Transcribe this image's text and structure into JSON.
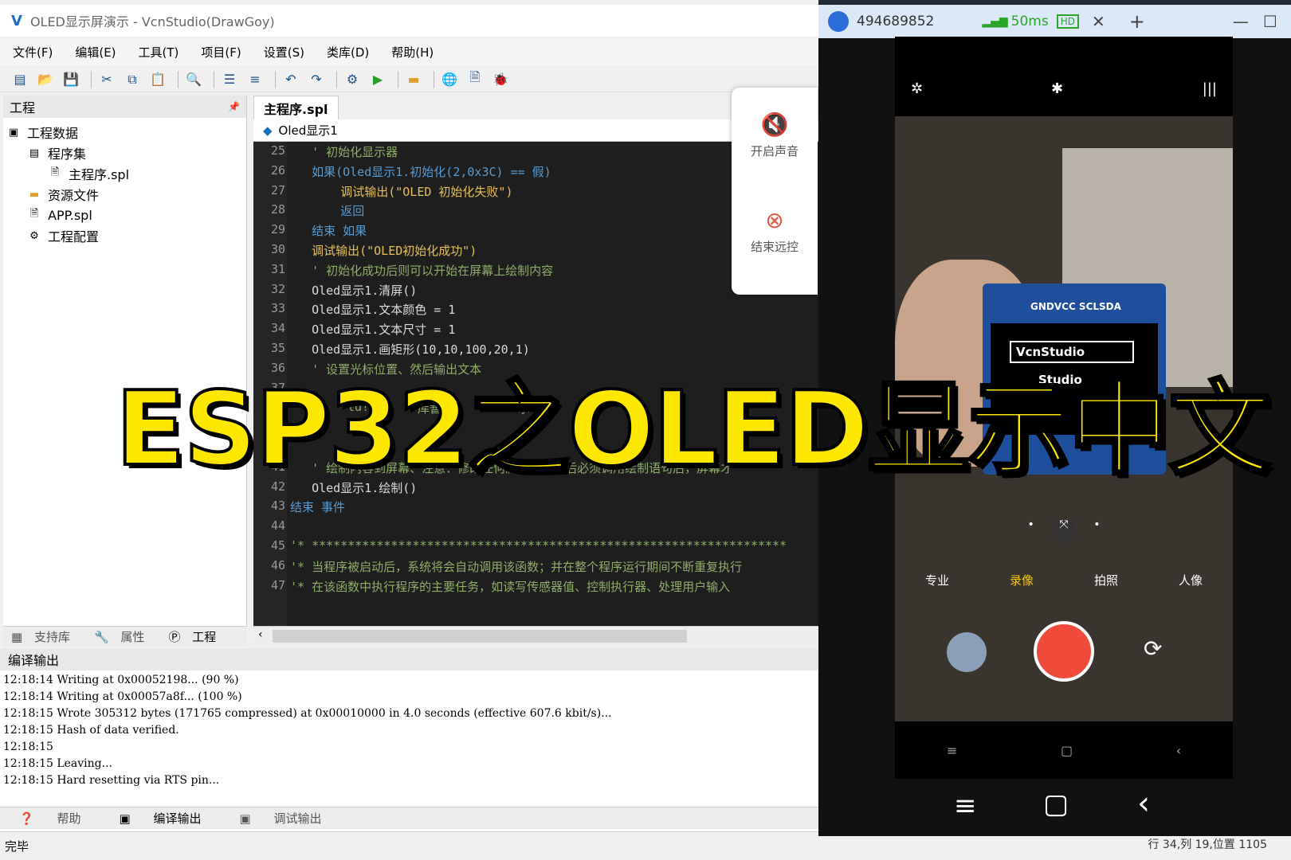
{
  "window": {
    "title": "OLED显示屏演示 - VcnStudio(DrawGoy)",
    "logo": "V"
  },
  "menu": [
    "文件(F)",
    "编辑(E)",
    "工具(T)",
    "项目(F)",
    "设置(S)",
    "类库(D)",
    "帮助(H)"
  ],
  "project_panel": {
    "title": "工程",
    "pin": "📌",
    "items": [
      "工程数据",
      "程序集",
      "主程序.spl",
      "资源文件",
      "APP.spl",
      "工程配置"
    ],
    "tabs": [
      "支持库",
      "属性",
      "工程"
    ]
  },
  "editor": {
    "tab": "主程序.spl",
    "object_combo": "Oled显示1",
    "lines": [
      {
        "n": "25",
        "text": "   ' 初始化显示器"
      },
      {
        "n": "26",
        "text": "   如果(Oled显示1.初始化(2,0x3C) == 假)"
      },
      {
        "n": "27",
        "text": "       调试输出(\"OLED 初始化失败\")"
      },
      {
        "n": "28",
        "text": "       返回"
      },
      {
        "n": "29",
        "text": "   结束 如果"
      },
      {
        "n": "30",
        "text": "   调试输出(\"OLED初始化成功\")"
      },
      {
        "n": "31",
        "text": "   ' 初始化成功后则可以开始在屏幕上绘制内容"
      },
      {
        "n": "32",
        "text": "   Oled显示1.清屏()"
      },
      {
        "n": "33",
        "text": "   Oled显示1.文本颜色 = 1"
      },
      {
        "n": "34",
        "text": "   Oled显示1.文本尺寸 = 1"
      },
      {
        "n": "35",
        "text": "   Oled显示1.画矩形(10,10,100,20,1)"
      },
      {
        "n": "36",
        "text": "   ' 设置光标位置、然后输出文本"
      },
      {
        "n": "37",
        "text": ""
      },
      {
        "n": "38",
        "text": ""
      },
      {
        "n": "39",
        "text": ""
      },
      {
        "n": "40",
        "text": ""
      },
      {
        "n": "41",
        "text": "   ' 绘制内容到屏幕、注意：修改任何属性或内容后必须调用绘制语句后，屏幕才"
      },
      {
        "n": "42",
        "text": "   Oled显示1.绘制()"
      },
      {
        "n": "43",
        "text": "结束 事件"
      },
      {
        "n": "44",
        "text": ""
      },
      {
        "n": "45",
        "text": "'* ******************************************************************"
      },
      {
        "n": "46",
        "text": "'* 当程序被启动后，系统将会自动调用该函数；并在整个程序运行期间不断重复执行"
      },
      {
        "n": "47",
        "text": "'* 在该函数中执行程序的主要任务，如读写传感器值、控制执行器、处理用户输入"
      }
    ],
    "hidden_fragments": [
      "ld!",
      "库暂不",
      "示"
    ]
  },
  "side_popup": {
    "sound_label": "开启声音",
    "stop_label": "结束远控"
  },
  "output": {
    "title": "编译输出",
    "lines": [
      "12:18:14 Writing at 0x00052198... (90 %)",
      "12:18:14 Writing at 0x00057a8f... (100 %)",
      "12:18:15 Wrote 305312 bytes (171765 compressed) at 0x00010000 in 4.0 seconds (effective 607.6 kbit/s)...",
      "12:18:15 Hash of data verified.",
      "12:18:15",
      "12:18:15 Leaving...",
      "12:18:15 Hard resetting via RTS pin..."
    ],
    "tabs": [
      "帮助",
      "编译输出",
      "调试输出"
    ]
  },
  "statusbar": {
    "left": "完毕",
    "right": "行 34,列 19,位置 1105"
  },
  "remote": {
    "id": "494689852",
    "latency": "50ms",
    "hd": "HD",
    "camera_modes": [
      "专业",
      "录像",
      "拍照",
      "人像"
    ],
    "oled": {
      "header": "GNDVCC SCLSDA",
      "line1": "VcnStudio",
      "line2": "Studio"
    }
  },
  "overlay": {
    "title": "ESP32之OLED显示中文"
  },
  "colors": {
    "keyword": "#569cd6",
    "func": "#e6c15a",
    "comment": "#8fae6a",
    "text": "#dcdcdc",
    "accent_yellow": "#ffe800",
    "record_red": "#f04a3a"
  }
}
